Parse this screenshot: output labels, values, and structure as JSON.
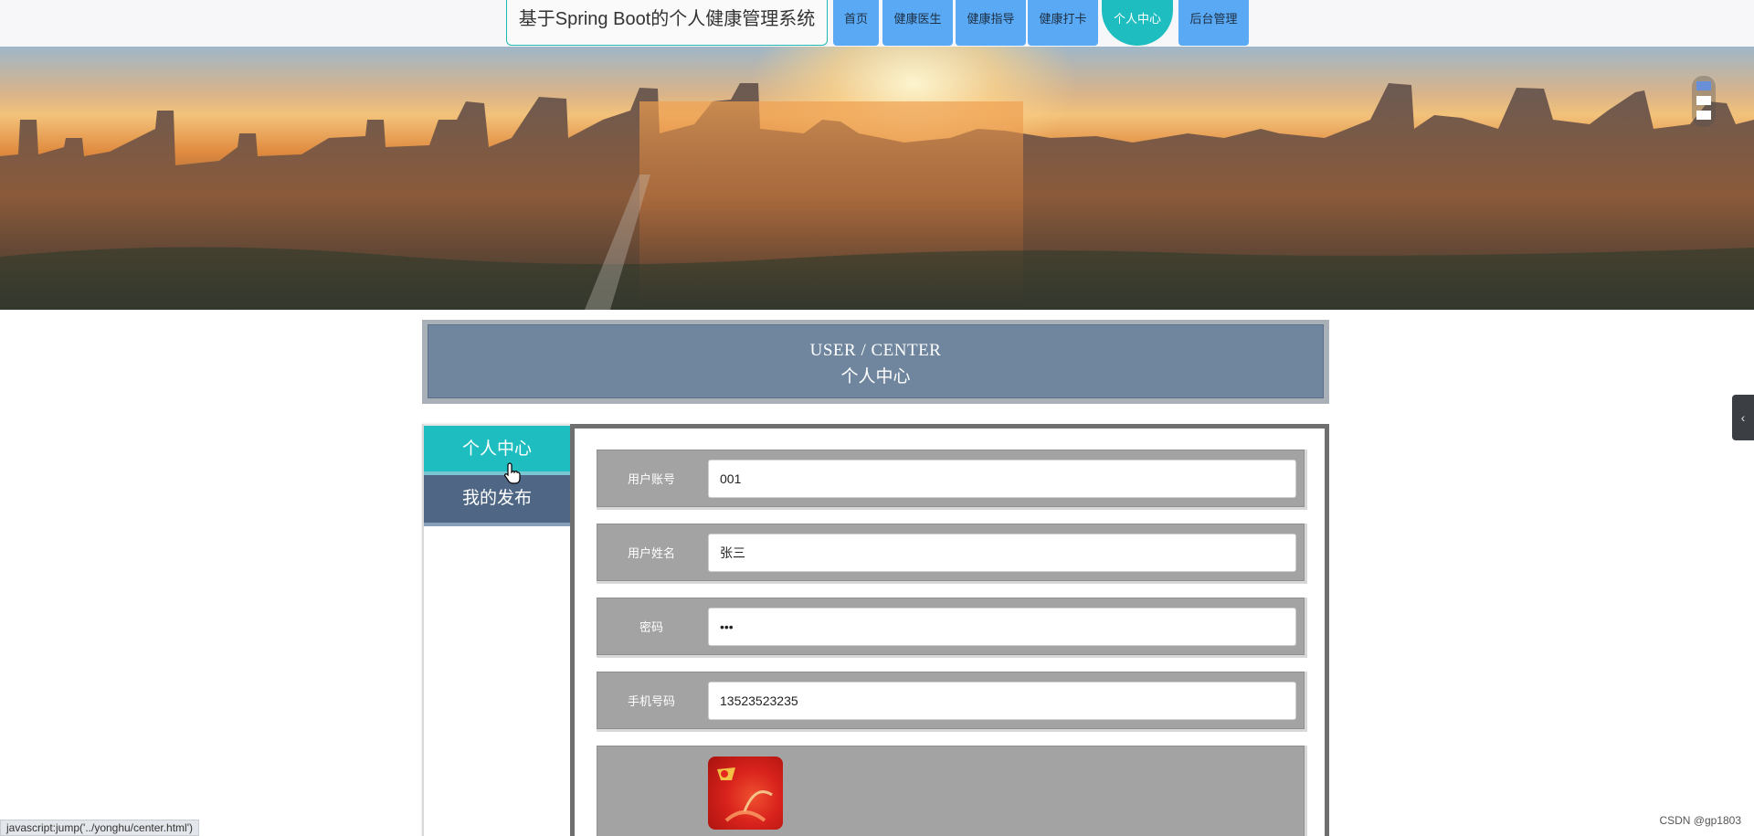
{
  "site_title": "基于Spring Boot的个人健康管理系统",
  "nav": [
    "首页",
    "健康医生",
    "健康指导",
    "健康打卡",
    "个人中心",
    "后台管理"
  ],
  "nav_active": "个人中心",
  "section": {
    "title_en": "USER / CENTER",
    "title_zh": "个人中心"
  },
  "side_menu": [
    "个人中心",
    "我的发布"
  ],
  "side_menu_active": "个人中心",
  "form": {
    "account": {
      "label": "用户账号",
      "value": "001"
    },
    "name": {
      "label": "用户姓名",
      "value": "张三"
    },
    "password": {
      "label": "密码",
      "value": "***"
    },
    "phone": {
      "label": "手机号码",
      "value": "13523523235"
    }
  },
  "status_url": "javascript:jump('../yonghu/center.html')",
  "watermark": "CSDN @gp1803",
  "colors": {
    "accent": "#1ebdc0",
    "nav_button": "#5aa9f4",
    "side_menu_inactive": "#4f6784",
    "header_box": "#6f869e",
    "form_row": "#a3a3a3"
  },
  "icons": [
    "hand-pointer-icon",
    "chevron-left-icon",
    "avatar-image"
  ]
}
